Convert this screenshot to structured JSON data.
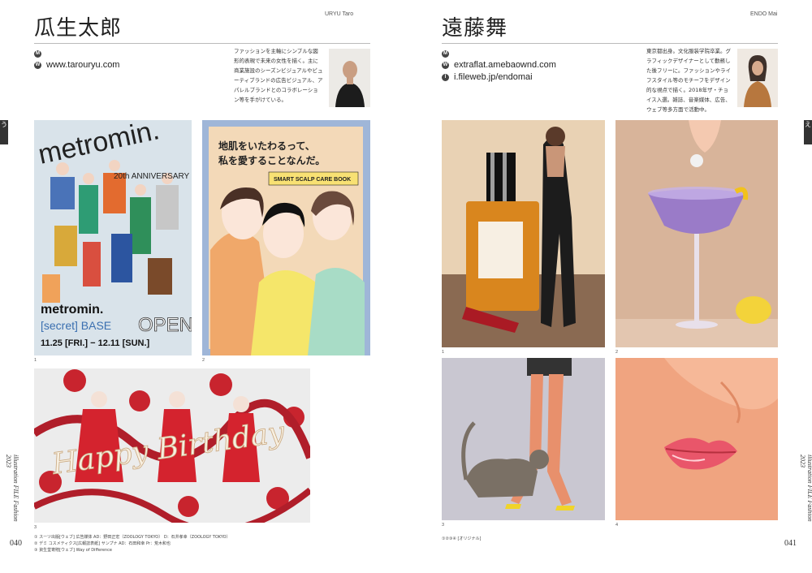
{
  "left": {
    "name_jp": "瓜生太郎",
    "name_en": "URYU Taro",
    "mail_icon": "M",
    "web_icon": "W",
    "website": "www.tarouryu.com",
    "bio": "ファッションを主軸にシンプルな図形的表現で未来の女性を描く。主に商業施設のシーズンビジュアルやビューティブランドの広告ビジュアル、アパレルブランドとのコラボレーション等を手がけている。",
    "side_tab": "う",
    "captions": [
      "1",
      "2",
      "3"
    ],
    "poster1": {
      "title": "metromin.",
      "sub": "20th ANNIVERSARY",
      "bottom1": "metromin.",
      "bottom2": "[secret] BASE",
      "open": "OPEN",
      "dates": "11.25 [FRI.] − 12.11 [SUN.]"
    },
    "poster2": {
      "headline1": "地肌をいたわるって、",
      "headline2": "私を愛することなんだ。",
      "badge": "SMART SCALP CARE BOOK"
    },
    "poster3": {
      "text": "Happy Birthday"
    },
    "credits": [
      "① スーツ出版[ウェブ] 広告媒体 AD：野田正宏（ZOOLOGY TOKYO） D：石井孝幸（ZOOLOGY TOKYO）",
      "② デミ コスメティクス[広報誌表紙] サンプナ AD：石田和幸 Pr：荒木和也",
      "③ 資生堂寄贈[ウェブ] Way of Difference"
    ],
    "page_num": "040",
    "spine": "illustration FILE Fashion 2023"
  },
  "right": {
    "name_jp": "遠藤舞",
    "name_en": "ENDO Mai",
    "mail_icon": "M",
    "web_icon": "W",
    "insta_icon": "I",
    "website": "extraflat.amebaownd.com",
    "fileweb": "i.fileweb.jp/endomai",
    "bio": "東京都出身。文化服装学院卒業。グラフィックデザイナーとして勤務した後フリーに。ファッションやライフスタイル等のモチーフをデザイン的な視点で描く。2018年ザ・チョイス入選。雑誌、音楽媒体、広告、ウェブ等多方面で活動中。",
    "side_tab": "え",
    "captions": [
      "1",
      "2",
      "3",
      "4"
    ],
    "credits": "①②③④ [オリジナル]",
    "page_num": "041",
    "spine": "illustration FILE Fashion 2023"
  },
  "colors": {
    "poster1_bg": "#d9e3ea",
    "poster2_bg": "#f3d9b8",
    "poster2_frame": "#9fb6d8",
    "poster3_bg": "#ececec",
    "endo1_bg": "#e9d2b4",
    "endo2_bg": "#d8b49a",
    "endo3_bg": "#c9c7d1",
    "endo4_bg": "#f0a480"
  }
}
